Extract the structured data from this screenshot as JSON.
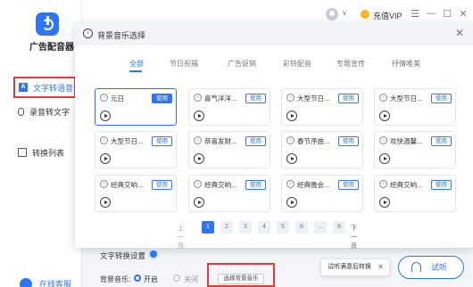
{
  "app": {
    "name": "广告配音器",
    "logo_icon": "app-logo-icon"
  },
  "sidebar": {
    "items": [
      {
        "label": "文字转语音",
        "icon": "text-to-speech-icon",
        "active": true
      },
      {
        "label": "录音转文字",
        "icon": "microphone-icon",
        "active": false
      },
      {
        "label": "转换列表",
        "icon": "list-icon",
        "active": false
      }
    ],
    "footer": "在线客服"
  },
  "titlebar": {
    "vip_label": "充值VIP"
  },
  "dialog": {
    "title": "背景音乐选择",
    "tabs": [
      "全部",
      "节日祝福",
      "广告促销",
      "彩铃配音",
      "专题宣传",
      "抒情唯美"
    ],
    "active_tab": "全部",
    "cards": [
      {
        "name": "元日",
        "use": "使用",
        "selected": true
      },
      {
        "name": "喜气洋洋...",
        "use": "使用",
        "selected": false
      },
      {
        "name": "大型节日...",
        "use": "使用",
        "selected": false
      },
      {
        "name": "大型节日...",
        "use": "使用",
        "selected": false
      },
      {
        "name": "大型节日...",
        "use": "使用",
        "selected": false
      },
      {
        "name": "恭喜发财...",
        "use": "使用",
        "selected": false
      },
      {
        "name": "春节序曲...",
        "use": "使用",
        "selected": false
      },
      {
        "name": "欢快温馨...",
        "use": "使用",
        "selected": false
      },
      {
        "name": "经典交响...",
        "use": "使用",
        "selected": false
      },
      {
        "name": "经典交响...",
        "use": "使用",
        "selected": false
      },
      {
        "name": "经典晚会...",
        "use": "使用",
        "selected": false
      },
      {
        "name": "经典交响...",
        "use": "使用",
        "selected": false
      }
    ],
    "pager": {
      "prev": "上一页",
      "pages": [
        "1",
        "2",
        "3",
        "4",
        "5",
        "6",
        "...",
        "8"
      ],
      "current": "1",
      "next": "下一页"
    }
  },
  "settings": {
    "title": "文字转换设置",
    "bgm_label": "背景音乐:",
    "on_label": "开启",
    "off_label": "关闭",
    "select_bgm": "选择背景音乐",
    "tooltip": "试听满意后转换",
    "listen": "试听"
  },
  "colors": {
    "accent": "#2f74f5",
    "highlight_box": "#e23b3b"
  }
}
